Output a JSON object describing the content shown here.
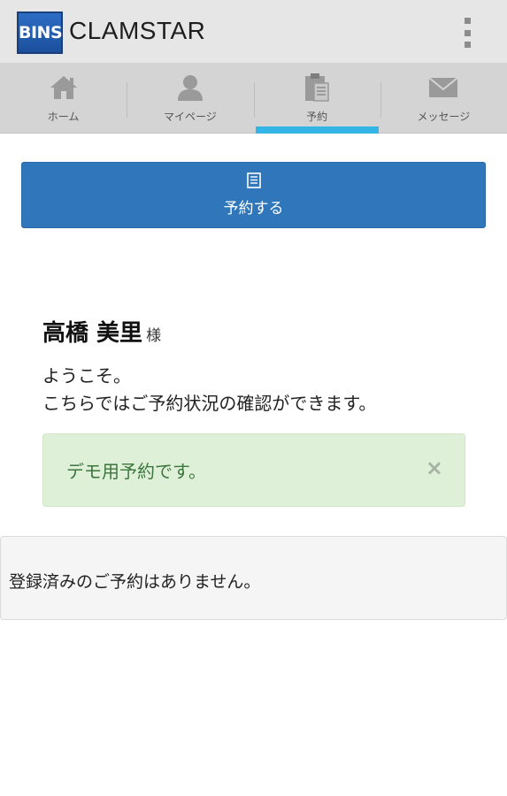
{
  "app": {
    "logo_text": "BINS",
    "title": "CLAMSTAR"
  },
  "tabs": [
    {
      "label": "ホーム",
      "icon": "home-icon"
    },
    {
      "label": "マイページ",
      "icon": "person-icon"
    },
    {
      "label": "予約",
      "icon": "clipboard-icon",
      "active": true
    },
    {
      "label": "メッセージ",
      "icon": "envelope-icon"
    }
  ],
  "book_button": {
    "label": "予約する",
    "icon": "list-icon"
  },
  "user": {
    "name": "高橋 美里",
    "honorific": "様"
  },
  "welcome": {
    "line1": "ようこそ。",
    "line2": "こちらではご予約状況の確認ができます。"
  },
  "alert": {
    "message": "デモ用予約です。",
    "close": "×"
  },
  "reservations": {
    "empty_message": "登録済みのご予約はありません。"
  },
  "colors": {
    "accent": "#33b5e5",
    "primary_button": "#2f76ba",
    "alert_bg": "#dff0d8",
    "alert_text": "#3c763d"
  }
}
